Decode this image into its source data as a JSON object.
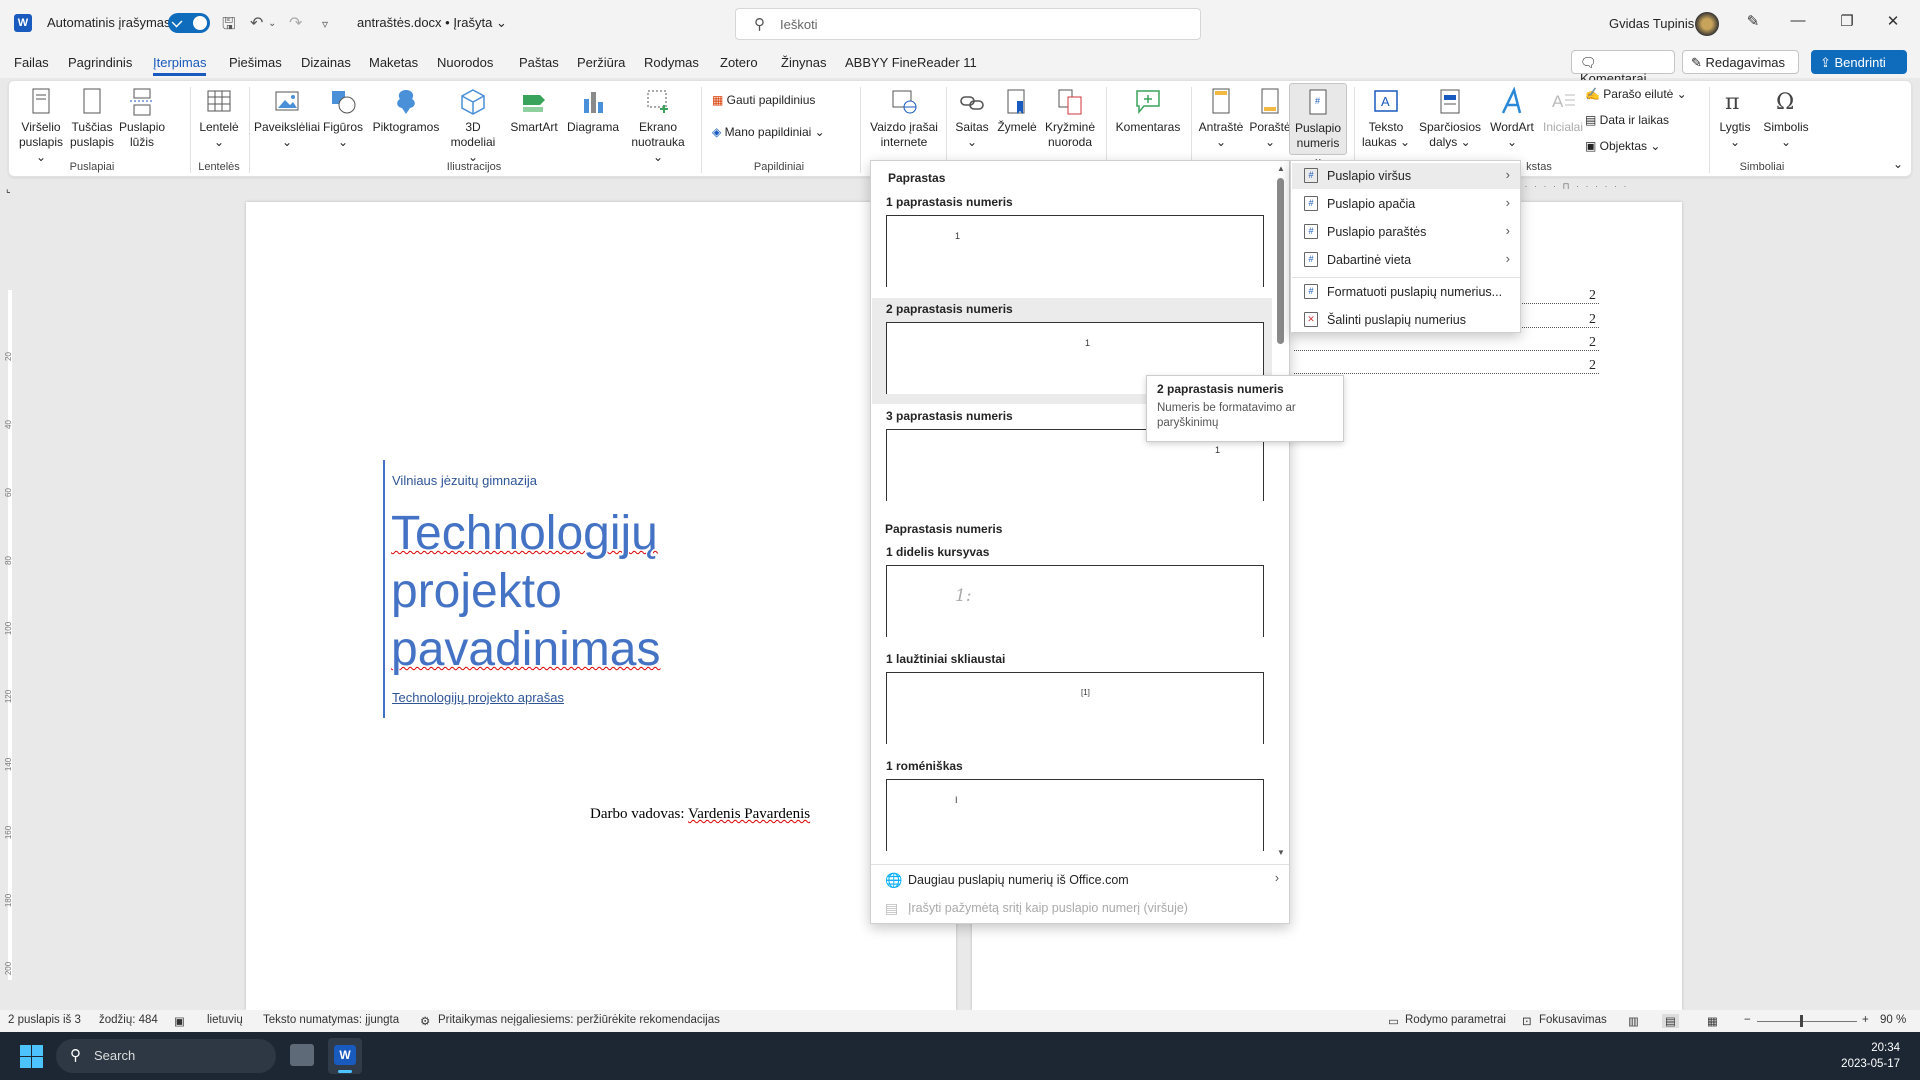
{
  "titlebar": {
    "autosave_label": "Automatinis įrašymas",
    "document_name": "antraštės.docx • Įrašyta ⌄",
    "search_placeholder": "Ieškoti",
    "user_name": "Gvidas Tupinis"
  },
  "menu": {
    "tabs": [
      "Failas",
      "Pagrindinis",
      "Įterpimas",
      "Piešimas",
      "Dizainas",
      "Maketas",
      "Nuorodos",
      "Paštas",
      "Peržiūra",
      "Rodymas",
      "Zotero",
      "Žinynas",
      "ABBYY FineReader 11"
    ],
    "active_tab": "Įterpimas",
    "comments_label": "Komentarai",
    "editing_label": "Redagavimas ⌄",
    "share_label": "Bendrinti ⌄"
  },
  "ribbon": {
    "buttons": {
      "cover_page": [
        "Viršelio",
        "puslapis ⌄"
      ],
      "blank_page": [
        "Tuščias",
        "puslapis"
      ],
      "page_break": [
        "Puslapio",
        "lūžis"
      ],
      "table": [
        "Lentelė",
        "⌄"
      ],
      "pictures": [
        "Paveikslėliai",
        "⌄"
      ],
      "shapes": [
        "Figūros",
        "⌄"
      ],
      "icons": [
        "Piktogramos",
        ""
      ],
      "models3d": [
        "3D",
        "modeliai ⌄"
      ],
      "smartart": [
        "SmartArt",
        ""
      ],
      "chart": [
        "Diagrama",
        ""
      ],
      "screenshot": [
        "Ekrano",
        "nuotrauka ⌄"
      ],
      "get_addins": "Gauti papildinius",
      "my_addins": "Mano papildiniai",
      "online_video": [
        "Vaizdo įrašai",
        "internete"
      ],
      "link": [
        "Saitas",
        "⌄"
      ],
      "bookmark": [
        "Žymelė",
        ""
      ],
      "cross_ref": [
        "Kryžminė",
        "nuoroda"
      ],
      "comment": [
        "Komentaras",
        ""
      ],
      "header": [
        "Antraštė",
        "⌄"
      ],
      "footer": [
        "Poraštė",
        "⌄"
      ],
      "page_number": [
        "Puslapio",
        "numeris ⌄"
      ],
      "text_box": [
        "Teksto",
        "laukas ⌄"
      ],
      "quick_parts": [
        "Sparčiosios",
        "dalys ⌄"
      ],
      "wordart": [
        "WordArt",
        "⌄"
      ],
      "drop_cap": [
        "Inicialai",
        ""
      ],
      "signature_line": "Parašo eilutė ⌄",
      "date_time": "Data ir laikas",
      "object": "Objektas ⌄",
      "equation": [
        "Lygtis",
        "⌄"
      ],
      "symbol": [
        "Simbolis",
        "⌄"
      ]
    },
    "groups": {
      "pages": "Puslapiai",
      "tables": "Lentelės",
      "illustrations": "Iliustracijos",
      "addins": "Papildiniai",
      "text": "kstas",
      "symbols": "Simboliai"
    }
  },
  "ruler": {
    "h_marker": "140",
    "v_labels": [
      "20",
      "40",
      "60",
      "80",
      "100",
      "120",
      "140",
      "160",
      "180",
      "200"
    ]
  },
  "document": {
    "school": "Vilniaus jėzuitų gimnazija",
    "title_lines": [
      "Technologijų",
      "projekto",
      "pavadinimas"
    ],
    "subtitle": "Technologijų projekto aprašas",
    "supervisor_label": "Darbo vadovas: ",
    "supervisor_name": "Vardenis Pavardenis",
    "toc_numbers": [
      "2",
      "2",
      "2",
      "2"
    ]
  },
  "gallery": {
    "section1": "Paprastas",
    "items": [
      {
        "title": "1 paprastasis numeris",
        "num": "1"
      },
      {
        "title": "2 paprastasis numeris",
        "num": "1"
      },
      {
        "title": "3 paprastasis numeris",
        "num": "1"
      }
    ],
    "section2": "Paprastasis numeris",
    "items2": [
      {
        "title": "1 didelis kursyvas",
        "num": "1:"
      },
      {
        "title": "1 laužtiniai skliaustai",
        "num": "[1]"
      },
      {
        "title": "1 roméniškas",
        "num": "I"
      }
    ],
    "more_label": "Daugiau puslapių numerių iš Office.com",
    "save_label": "Įrašyti pažymėtą sritį kaip puslapio numerį (viršuje)"
  },
  "submenu": {
    "items": [
      "Puslapio viršus",
      "Puslapio apačia",
      "Puslapio paraštės",
      "Dabartinė vieta",
      "Formatuoti puslapių numerius...",
      "Šalinti puslapių numerius"
    ]
  },
  "tooltip": {
    "title": "2 paprastasis numeris",
    "description": "Numeris be formatavimo ar paryškinimų"
  },
  "statusbar": {
    "page": "2 puslapis iš 3",
    "words": "žodžių: 484",
    "language": "lietuvių",
    "text_prediction": "Teksto numatymas: įjungta",
    "accessibility": "Pritaikymas neįgaliesiems: peržiūrėkite rekomendacijas",
    "display_settings": "Rodymo parametrai",
    "focus": "Fokusavimas",
    "zoom": "90 %"
  },
  "taskbar": {
    "search_label": "Search",
    "time": "20:34",
    "date": "2023-05-17"
  },
  "colors": {
    "accent": "#185abd",
    "title_blue": "#4472c4",
    "taskbar": "#1c2733"
  }
}
